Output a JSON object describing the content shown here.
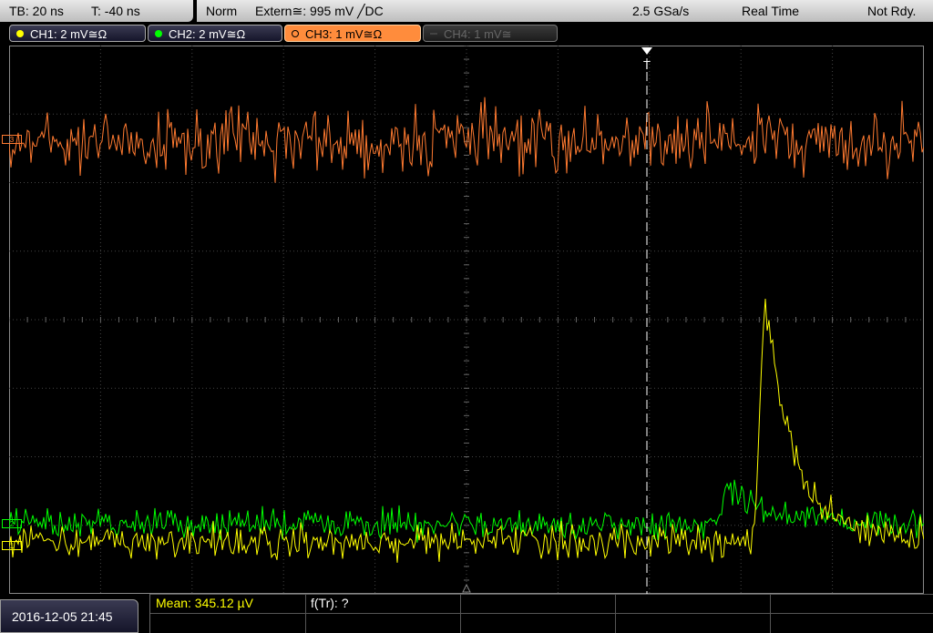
{
  "header": {
    "timebase": "TB: 20 ns",
    "trigger_offset": "T: -40 ns",
    "mode": "Norm",
    "trigger_source": "Extern≅: 995 mV ╱DC",
    "sample_rate": "2.5 GSa/s",
    "acquisition": "Real Time",
    "status": "Not Rdy."
  },
  "channels": [
    {
      "label": "CH1: 2 mV≅Ω",
      "color": "#ffff00",
      "active": true
    },
    {
      "label": "CH2: 2 mV≅Ω",
      "color": "#00ff00",
      "active": true
    },
    {
      "label": "CH3: 1 mV≅Ω",
      "color": "#ff8c3c",
      "active": true
    },
    {
      "label": "CH4: 1 mV≅",
      "color": "#555555",
      "active": false
    }
  ],
  "trigger_marker": "T",
  "bottom": {
    "datetime": "2016-12-05 21:45",
    "meas1": "Mean: 345.12 µV",
    "meas2": "f(Tr): ?"
  },
  "colors": {
    "ch1": "#ffff00",
    "ch2": "#00ff00",
    "ch3": "#ff7a30",
    "grid": "#444444",
    "background": "#000000"
  }
}
